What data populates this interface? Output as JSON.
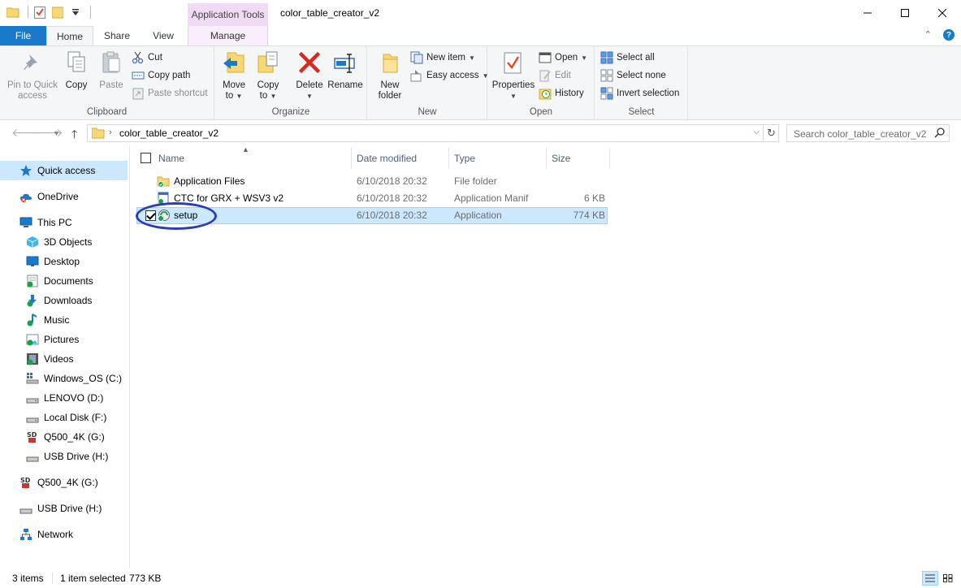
{
  "window": {
    "title": "color_table_creator_v2",
    "context_tab_group": "Application Tools",
    "controls": {
      "minimize": "—",
      "maximize": "☐",
      "close": "✕"
    }
  },
  "tabs": {
    "file": "File",
    "home": "Home",
    "share": "Share",
    "view": "View",
    "manage": "Manage",
    "collapse": "⌃",
    "help": "?"
  },
  "ribbon": {
    "clipboard": {
      "label": "Clipboard",
      "pin_label_1": "Pin to Quick",
      "pin_label_2": "access",
      "copy": "Copy",
      "paste": "Paste",
      "cut": "Cut",
      "copy_path": "Copy path",
      "paste_shortcut": "Paste shortcut"
    },
    "organize": {
      "label": "Organize",
      "move_to_1": "Move",
      "move_to_2": "to",
      "copy_to_1": "Copy",
      "copy_to_2": "to",
      "delete": "Delete",
      "rename": "Rename"
    },
    "new": {
      "label": "New",
      "new_folder_1": "New",
      "new_folder_2": "folder",
      "new_item": "New item",
      "easy_access": "Easy access"
    },
    "open": {
      "label": "Open",
      "properties": "Properties",
      "open": "Open",
      "edit": "Edit",
      "history": "History"
    },
    "select": {
      "label": "Select",
      "select_all": "Select all",
      "select_none": "Select none",
      "invert_selection": "Invert selection"
    }
  },
  "address": {
    "path": "color_table_creator_v2",
    "search_placeholder": "Search color_table_creator_v2"
  },
  "nav": {
    "quick_access": "Quick access",
    "onedrive": "OneDrive",
    "this_pc": "This PC",
    "objects3d": "3D Objects",
    "desktop": "Desktop",
    "documents": "Documents",
    "downloads": "Downloads",
    "music": "Music",
    "pictures": "Pictures",
    "videos": "Videos",
    "windows_os": "Windows_OS (C:)",
    "lenovo": "LENOVO (D:)",
    "local_disk": "Local Disk (F:)",
    "q500_sub": "Q500_4K (G:)",
    "usb_sub": "USB Drive (H:)",
    "q500": "Q500_4K (G:)",
    "usb": "USB Drive (H:)",
    "network": "Network"
  },
  "columns": {
    "name": "Name",
    "date_modified": "Date modified",
    "type": "Type",
    "size": "Size"
  },
  "files": [
    {
      "name": "Application Files",
      "date": "6/10/2018 20:32",
      "type": "File folder",
      "size": ""
    },
    {
      "name": "CTC for GRX + WSV3 v2",
      "date": "6/10/2018 20:32",
      "type": "Application Manif",
      "size": "6 KB"
    },
    {
      "name": "setup",
      "date": "6/10/2018 20:32",
      "type": "Application",
      "size": "774 KB"
    }
  ],
  "status": {
    "items": "3 items",
    "selected": "1 item selected",
    "size": "773 KB"
  },
  "colors": {
    "accent": "#1979ca",
    "selection": "#cce8ff",
    "selection_border": "#99d1ff",
    "context_tab": "#f0dbf5",
    "annotation_ring": "#2b3cb8"
  }
}
